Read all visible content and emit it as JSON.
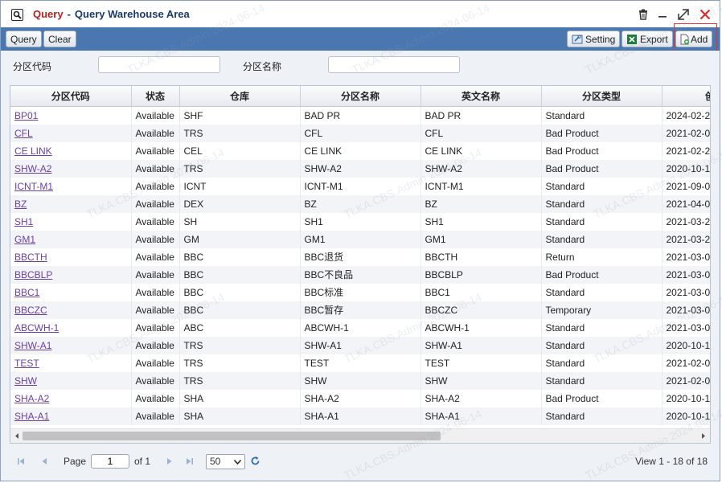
{
  "window": {
    "title_primary": "Query",
    "title_separator": "-",
    "title_secondary": "Query Warehouse Area"
  },
  "toolbar": {
    "query_label": "Query",
    "clear_label": "Clear",
    "setting_label": "Setting",
    "export_label": "Export",
    "add_label": "Add"
  },
  "filter": {
    "code_label": "分区代码",
    "code_value": "",
    "name_label": "分区名称",
    "name_value": ""
  },
  "grid": {
    "columns": [
      "分区代码",
      "状态",
      "仓库",
      "分区名称",
      "英文名称",
      "分区类型",
      "创"
    ],
    "rows": [
      [
        "BP01",
        "Available",
        "SHF",
        "BAD PR",
        "BAD PR",
        "Standard",
        "2024-02-2"
      ],
      [
        "CFL",
        "Available",
        "TRS",
        "CFL",
        "CFL",
        "Bad Product",
        "2021-02-0"
      ],
      [
        "CE LINK",
        "Available",
        "CEL",
        "CE LINK",
        "CE LINK",
        "Bad Product",
        "2021-02-2"
      ],
      [
        "SHW-A2",
        "Available",
        "TRS",
        "SHW-A2",
        "SHW-A2",
        "Bad Product",
        "2020-10-1"
      ],
      [
        "ICNT-M1",
        "Available",
        "ICNT",
        "ICNT-M1",
        "ICNT-M1",
        "Standard",
        "2021-09-0"
      ],
      [
        "BZ",
        "Available",
        "DEX",
        "BZ",
        "BZ",
        "Standard",
        "2021-04-0"
      ],
      [
        "SH1",
        "Available",
        "SH",
        "SH1",
        "SH1",
        "Standard",
        "2021-03-2"
      ],
      [
        "GM1",
        "Available",
        "GM",
        "GM1",
        "GM1",
        "Standard",
        "2021-03-2"
      ],
      [
        "BBCTH",
        "Available",
        "BBC",
        "BBC退货",
        "BBCTH",
        "Return",
        "2021-03-0"
      ],
      [
        "BBCBLP",
        "Available",
        "BBC",
        "BBC不良品",
        "BBCBLP",
        "Bad Product",
        "2021-03-0"
      ],
      [
        "BBC1",
        "Available",
        "BBC",
        "BBC标准",
        "BBC1",
        "Standard",
        "2021-03-0"
      ],
      [
        "BBCZC",
        "Available",
        "BBC",
        "BBC暂存",
        "BBCZC",
        "Temporary",
        "2021-03-0"
      ],
      [
        "ABCWH-1",
        "Available",
        "ABC",
        "ABCWH-1",
        "ABCWH-1",
        "Standard",
        "2021-03-0"
      ],
      [
        "SHW-A1",
        "Available",
        "TRS",
        "SHW-A1",
        "SHW-A1",
        "Standard",
        "2020-10-1"
      ],
      [
        "TEST",
        "Available",
        "TRS",
        "TEST",
        "TEST",
        "Standard",
        "2021-02-0"
      ],
      [
        "SHW",
        "Available",
        "TRS",
        "SHW",
        "SHW",
        "Standard",
        "2021-02-0"
      ],
      [
        "SHA-A2",
        "Available",
        "SHA",
        "SHA-A2",
        "SHA-A2",
        "Bad Product",
        "2020-10-1"
      ],
      [
        "SHA-A1",
        "Available",
        "SHA",
        "SHA-A1",
        "SHA-A1",
        "Standard",
        "2020-10-1"
      ]
    ]
  },
  "pager": {
    "page_label": "Page",
    "page_value": "1",
    "of_label": "of 1",
    "page_size": "50",
    "view_text": "View 1 - 18 of 18"
  },
  "watermark": "TLKA.CBS.Admin 2024-06-14",
  "colors": {
    "toolbar_bg": "#4a77b0",
    "title_query": "#b22222",
    "title_text": "#1a3a6a",
    "link": "#6a3fa8",
    "close_icon": "#e02020"
  },
  "icons": {
    "title": "search-window-icon",
    "delete": "trash-icon",
    "minimize": "minimize-icon",
    "maximize": "maximize-icon",
    "close": "close-icon",
    "setting": "setting-icon",
    "export": "excel-icon",
    "add": "add-document-icon"
  }
}
